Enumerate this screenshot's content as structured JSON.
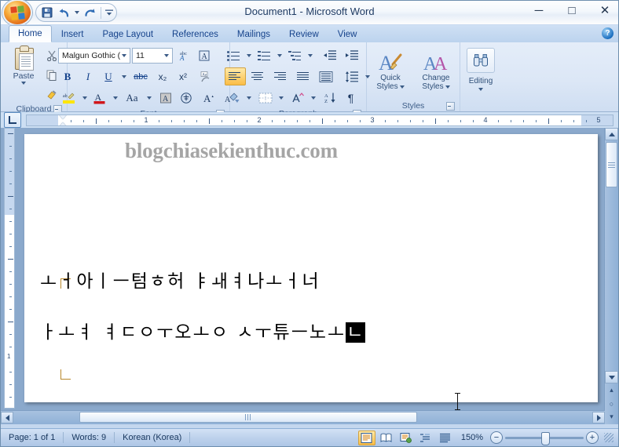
{
  "window": {
    "title": "Document1 - Microsoft Word",
    "minimize": "─",
    "maximize": "□",
    "close": "✕",
    "help": "?"
  },
  "quick_access": {
    "save": "save-icon",
    "undo": "undo-icon",
    "undo_caret": "▾",
    "redo": "redo-icon",
    "customize": "≡"
  },
  "tabs": [
    {
      "label": "Home",
      "active": true
    },
    {
      "label": "Insert",
      "active": false
    },
    {
      "label": "Page Layout",
      "active": false
    },
    {
      "label": "References",
      "active": false
    },
    {
      "label": "Mailings",
      "active": false
    },
    {
      "label": "Review",
      "active": false
    },
    {
      "label": "View",
      "active": false
    }
  ],
  "ribbon": {
    "clipboard": {
      "label": "Clipboard",
      "paste_label": "Paste",
      "cut": "scissors-icon",
      "copy": "copy-icon",
      "format_painter": "format-painter-icon"
    },
    "font": {
      "label": "Font",
      "font_name": "Malgun Gothic (",
      "font_size": "11",
      "grow_font": "A",
      "shrink_font": "A",
      "clear_formatting": "clear-formatting-icon",
      "bold": "B",
      "italic": "I",
      "underline": "U",
      "strikethrough": "abc",
      "subscript": "x₂",
      "superscript": "x²",
      "text_highlight": "ab",
      "font_color": "A",
      "change_case": "Aa",
      "shading": "A",
      "enclose_char": "缶",
      "phonetic": "A"
    },
    "paragraph": {
      "label": "Paragraph",
      "bullets": "bullets-icon",
      "numbering": "numbering-icon",
      "multilevel": "multilevel-list-icon",
      "decrease_indent": "decrease-indent-icon",
      "increase_indent": "increase-indent-icon",
      "align_left": "align-left-icon",
      "align_center": "align-center-icon",
      "align_right": "align-right-icon",
      "justify": "justify-icon",
      "distributed": "distributed-icon",
      "line_spacing": "line-spacing-icon",
      "shading": "shading-icon",
      "borders": "borders-icon",
      "asian_layout": "asian-layout-icon",
      "sort": "sort-icon",
      "show_marks": "¶"
    },
    "styles": {
      "label": "Styles",
      "quick_styles": "Quick\nStyles",
      "quick_styles_line1": "Quick",
      "quick_styles_line2": "Styles",
      "change_styles_line1": "Change",
      "change_styles_line2": "Styles"
    },
    "editing": {
      "label": "Editing",
      "icon": "binoculars-find-icon"
    }
  },
  "ruler": {
    "tab_selector": "left-tab-stop-icon",
    "h_numbers": [
      "1",
      "2",
      "3",
      "4",
      "5"
    ],
    "v_numbers": [
      "1"
    ]
  },
  "document": {
    "watermark": "blogchiasekienthuc.com",
    "line1": "ㅗㅓ아ㅣㅡ텀ㅎ허 ㅑㅙㅕ나ㅗㅓ너",
    "line2_text": "ㅏㅗㅕ ㅕㄷㅇㅜ오ㅗㅇ ㅅㅜ튜ㅡ노ㅗ",
    "line2_composing": "ㄴ"
  },
  "status": {
    "page": "Page: 1 of 1",
    "words": "Words: 9",
    "language": "Korean (Korea)",
    "zoom": "150%",
    "zoom_out": "−",
    "zoom_in": "+",
    "views": [
      {
        "name": "print-layout-view",
        "active": true
      },
      {
        "name": "full-screen-reading-view",
        "active": false
      },
      {
        "name": "web-layout-view",
        "active": false
      },
      {
        "name": "outline-view",
        "active": false
      },
      {
        "name": "draft-view",
        "active": false
      }
    ]
  },
  "scrollbars": {
    "up_arrow": "▲",
    "down_arrow": "▼",
    "left_arrow": "◀",
    "right_arrow": "▶",
    "prev_page": "▴",
    "select_browse_object": "○",
    "next_page": "▾"
  }
}
